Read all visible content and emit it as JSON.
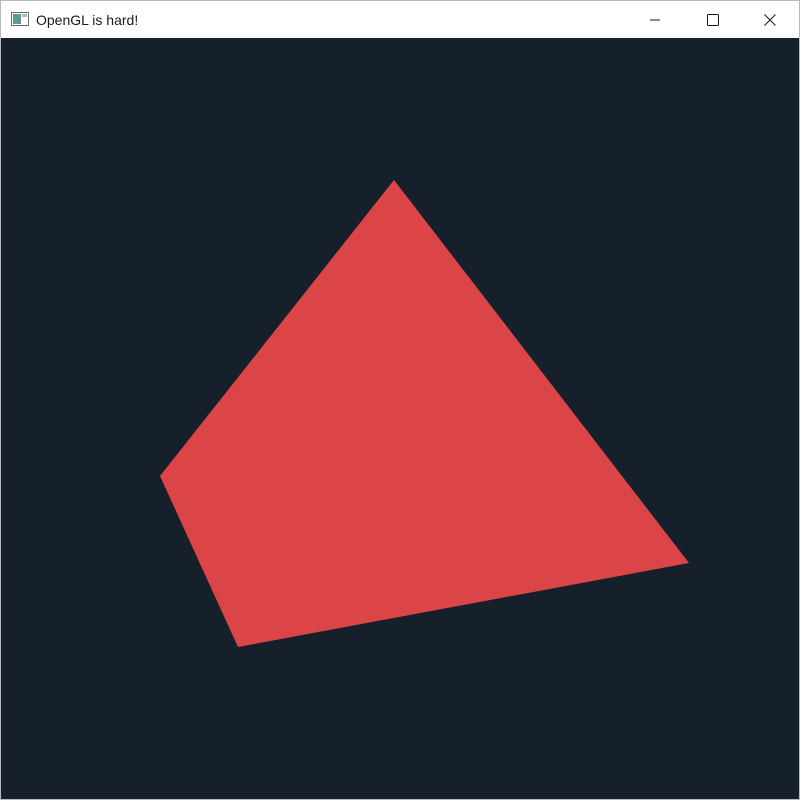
{
  "window": {
    "title": "OpenGL is hard!",
    "controls": {
      "minimize": "minimize-icon",
      "maximize": "maximize-icon",
      "close": "close-icon"
    }
  },
  "scene": {
    "clear_color": "#15202b",
    "shape": "quadrilateral",
    "fill_color": "#db4548"
  }
}
